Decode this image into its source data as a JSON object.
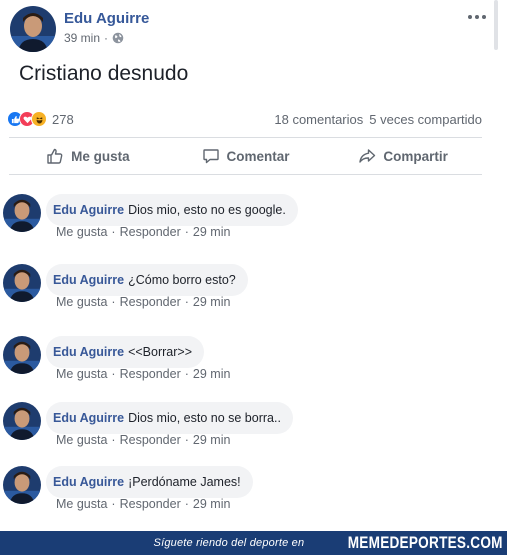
{
  "post": {
    "author": "Edu Aguirre",
    "time": "39 min",
    "separator": "·",
    "text": "Cristiano desnudo",
    "reaction_count": "278",
    "comments_count": "18 comentarios",
    "shares_count": "5 veces compartido",
    "reaction_icons": [
      "like-icon",
      "love-icon",
      "haha-icon"
    ]
  },
  "actions": {
    "like": "Me gusta",
    "comment": "Comentar",
    "share": "Compartir"
  },
  "comments": [
    {
      "name": "Edu Aguirre",
      "text": "Dios mio, esto no es google.",
      "like": "Me gusta",
      "reply": "Responder",
      "time": "29 min"
    },
    {
      "name": "Edu Aguirre",
      "text": "¿Cómo borro esto?",
      "like": "Me gusta",
      "reply": "Responder",
      "time": "29 min"
    },
    {
      "name": "Edu Aguirre",
      "text": "<<Borrar>>",
      "like": "Me gusta",
      "reply": "Responder",
      "time": "29 min"
    },
    {
      "name": "Edu Aguirre",
      "text": "Dios mio, esto no se borra..",
      "like": "Me gusta",
      "reply": "Responder",
      "time": "29 min"
    },
    {
      "name": "Edu Aguirre",
      "text": "¡Perdóname James!",
      "like": "Me gusta",
      "reply": "Responder",
      "time": "29 min"
    }
  ],
  "meta_separator": "·",
  "watermark": {
    "tagline": "Síguete riendo del deporte en",
    "brand": "MEMEDEPORTES.COM"
  },
  "colors": {
    "link_blue": "#365899",
    "muted_gray": "#616770",
    "bubble_gray": "#f2f3f5",
    "like_blue": "#1877f2",
    "love_red": "#f33e58",
    "haha_yellow": "#f7b125",
    "watermark_bg": "#1a3d75"
  }
}
